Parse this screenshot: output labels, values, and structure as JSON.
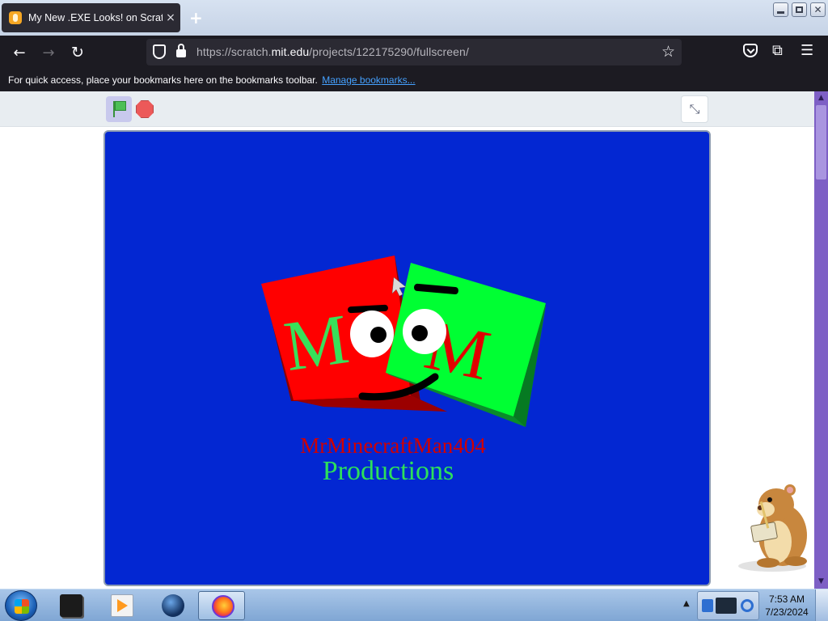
{
  "browser": {
    "tab_title": "My New .EXE Looks! on Scratch",
    "tab_close": "×",
    "new_tab": "+",
    "url_prefix": "https://scratch.",
    "url_host": "mit.edu",
    "url_path": "/projects/122175290/fullscreen/",
    "bookmarks_message": "For quick access, place your bookmarks here on the bookmarks toolbar.",
    "bookmarks_link": "Manage bookmarks..."
  },
  "nav": {
    "back_icon": "←",
    "forward_icon": "→",
    "reload_icon": "↻",
    "star_icon": "☆",
    "extensions_icon": "⧉",
    "menu_icon": "☰"
  },
  "window_controls": {
    "close": "✕"
  },
  "scratch": {
    "exit_fullscreen_icon": "⤡",
    "logo_letter_left": "M",
    "logo_letter_right": "M",
    "credit_line1": "MrMinecraftMan404",
    "credit_line2": "Productions",
    "colors": {
      "stage_bg": "#0327d2",
      "red_cube": "#ff0000",
      "green_cube": "#00ff33",
      "credit_red": "#d10000",
      "credit_green": "#2de05a"
    }
  },
  "scrollbar": {
    "up": "▲",
    "down": "▼"
  },
  "taskbar": {
    "tray_arrow": "▲",
    "time": "7:53 AM",
    "date": "7/23/2024"
  }
}
